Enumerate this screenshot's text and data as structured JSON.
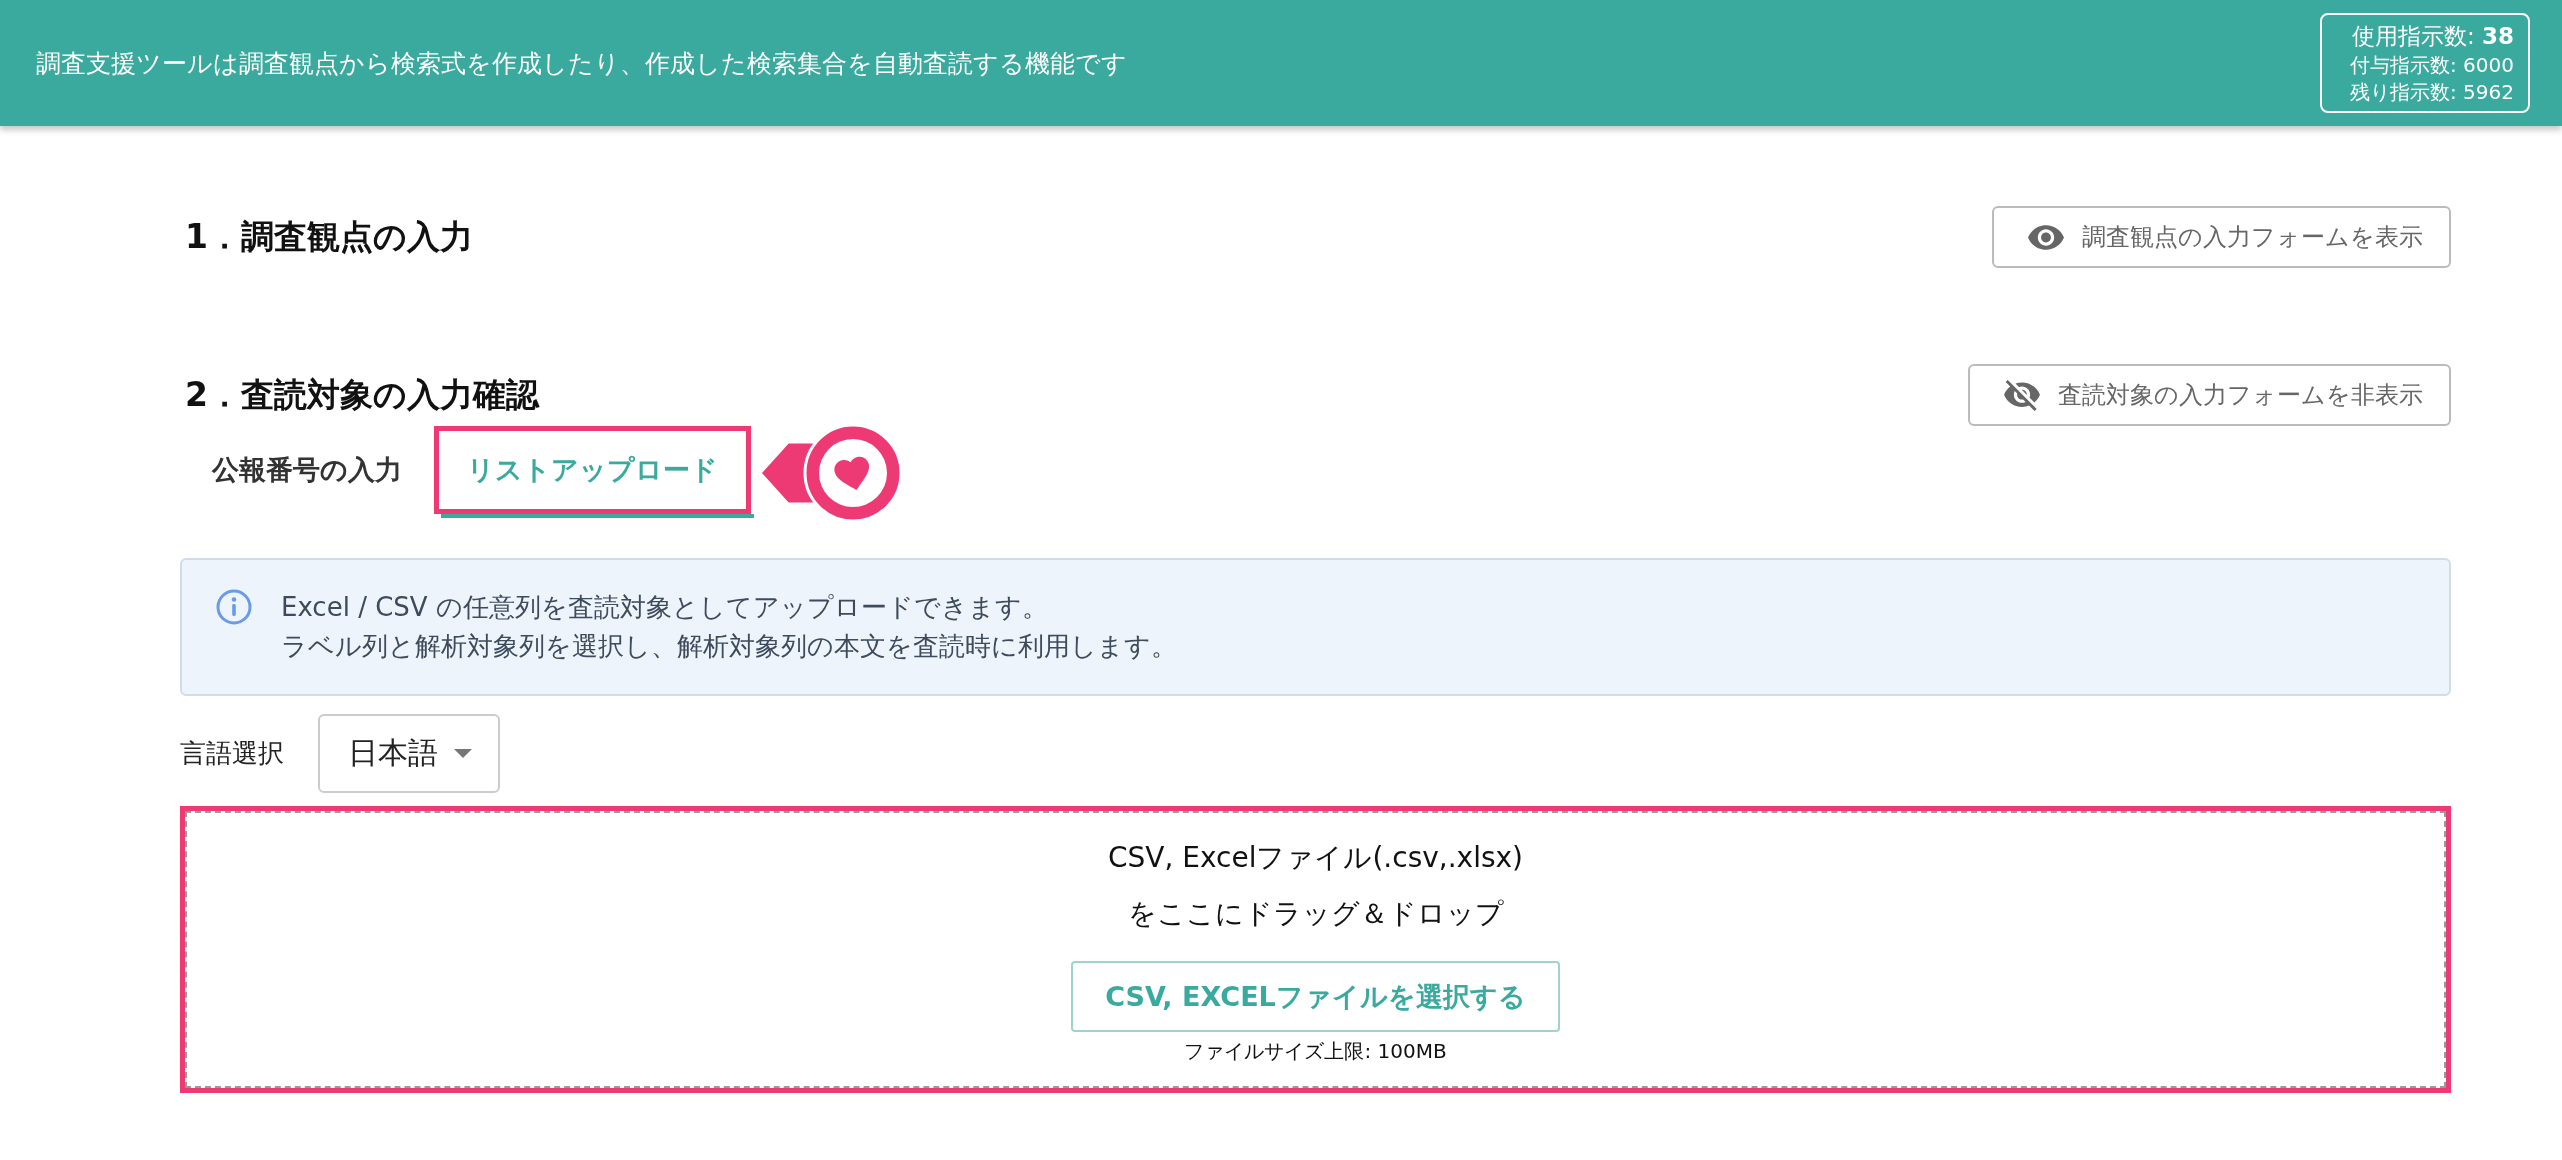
{
  "header": {
    "description": "調査支援ツールは調査観点から検索式を作成したり、作成した検索集合を自動査読する機能です",
    "usage": [
      "使用指示数: **38**",
      "付与指示数: 6000",
      "残り指示数: 5962"
    ]
  },
  "sections": [
    {
      "title": "1．調査観点の入力",
      "toggle": {
        "kind": "show",
        "label": "調査観点の入力フォームを表示"
      }
    },
    {
      "title": "2．査読対象の入力確認",
      "toggle": {
        "kind": "hide",
        "label": "査読対象の入力フォームを非表示"
      },
      "tabs": [
        {
          "label": "公報番号の入力",
          "selected": false,
          "highlighted": false
        },
        {
          "label": "リストアップロード",
          "selected": true,
          "highlighted": true
        }
      ],
      "info": {
        "lines": [
          "Excel / CSV の任意列を査読対象としてアップロードできます。",
          "ラベル列と解析対象列を選択し、解析対象列の本文を査読時に利用します。"
        ]
      },
      "language": {
        "label": "言語選択",
        "value": "日本語"
      },
      "dropzone": {
        "highlighted": true,
        "lines": [
          "CSV, Excelファイル(.csv,.xlsx)",
          "をここにドラッグ＆ドロップ"
        ],
        "button": "CSV, EXCELファイルを選択する",
        "note": "ファイルサイズ上限: 100MB"
      }
    }
  ]
}
